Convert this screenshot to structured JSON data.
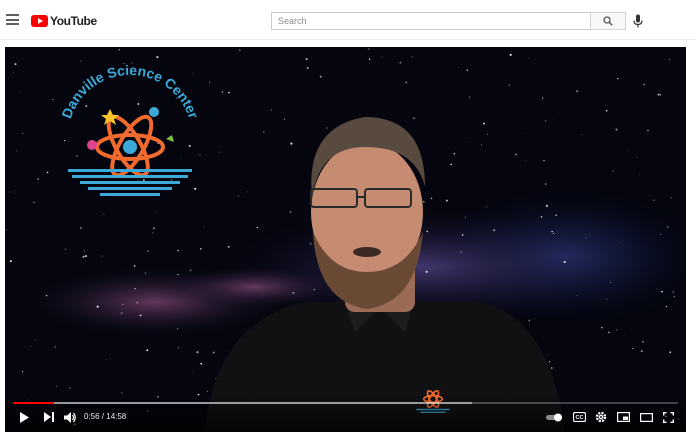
{
  "app": {
    "name": "YouTube"
  },
  "header": {
    "logo_text": "YouTube",
    "search": {
      "placeholder": "Search",
      "value": ""
    },
    "icons": [
      "menu-icon",
      "search-icon",
      "microphone-icon"
    ]
  },
  "video": {
    "overlay_logo": {
      "text": "Danville Science Center"
    },
    "player": {
      "current_time": "0:56",
      "duration": "14:58",
      "time_display": "0:56 / 14:58",
      "played_fraction": 0.062,
      "buffered_fraction": 0.69,
      "controls": [
        "play-icon",
        "next-icon",
        "volume-icon",
        "autoplay-toggle",
        "captions-icon",
        "settings-icon",
        "miniplayer-icon",
        "theater-icon",
        "fullscreen-icon"
      ]
    }
  },
  "colors": {
    "brand_red": "#ff0000",
    "sky": "#05060f",
    "text_dark": "#212121"
  }
}
